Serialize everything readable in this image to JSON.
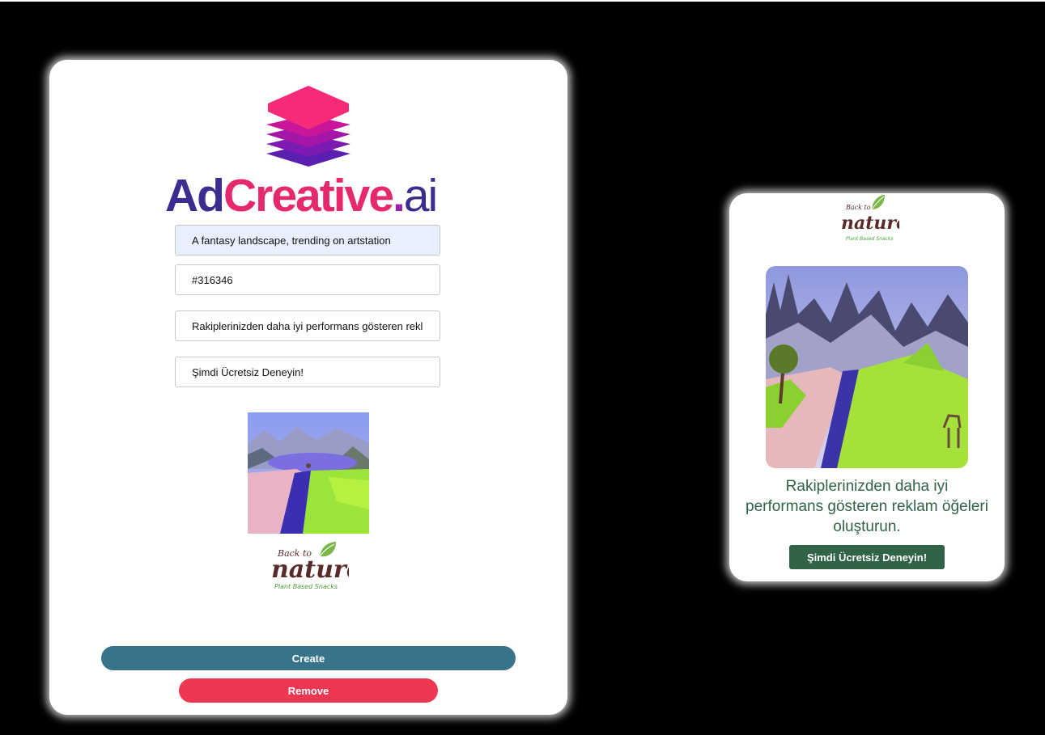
{
  "brand": {
    "word_ad": "Ad",
    "word_creative": "Creative",
    "word_dot": ".",
    "word_ai": "ai",
    "colors": {
      "layer_top": "#f72a7a",
      "layer_mid": "#c2189e",
      "layer_bottom": "#6a1fb0",
      "ad": "#3a2d8f",
      "creative": "#e6286d"
    }
  },
  "form": {
    "prompt_value": "A fantasy landscape, trending on artstation",
    "color_value": "#316346",
    "headline_value": "Rakiplerinizden daha iyi performans gösteren reklam öğeleri oluşturun.",
    "cta_value": "Şimdi Ücretsiz Deneyin!",
    "create_label": "Create",
    "remove_label": "Remove",
    "create_color": "#39738a",
    "remove_color": "#ee3750"
  },
  "preview_logo": {
    "line1": "Back to",
    "line2": "nature",
    "line3": "Plant Based Snacks"
  },
  "ad": {
    "headline": "Rakiplerinizden daha iyi performans gösteren reklam öğeleri oluşturun.",
    "cta_label": "Şimdi Ücretsiz Deneyin!",
    "accent_color": "#316346"
  }
}
